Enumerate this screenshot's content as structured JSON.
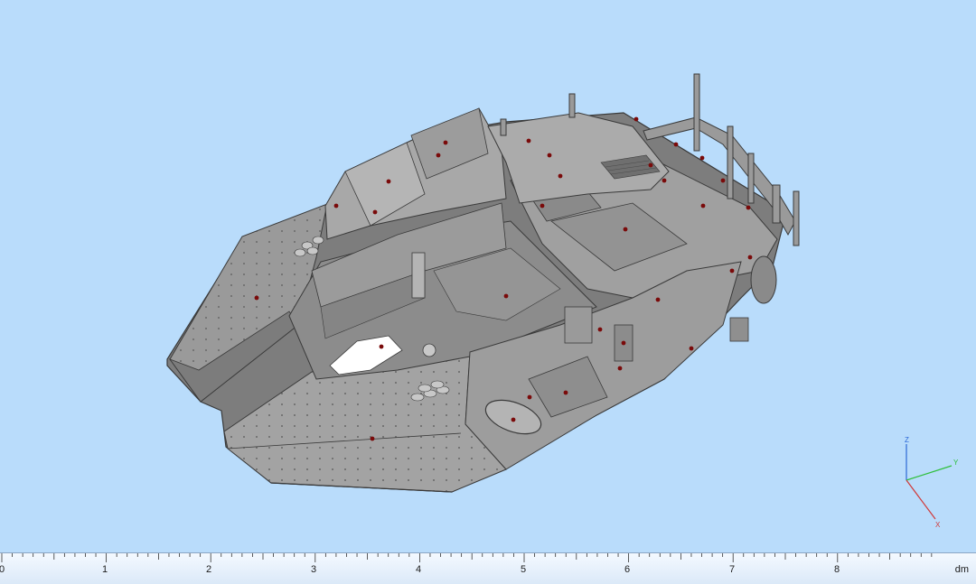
{
  "viewport": {
    "background": "#b9dcfb",
    "model": {
      "body_color": "#8e8e8e",
      "marker_color": "#7a0a0a"
    },
    "triad": {
      "z_label": "Z",
      "y_label": "Y",
      "x_label": "X",
      "z_color": "#2b66d6",
      "y_color": "#2fbf3c",
      "x_color": "#d03a3a"
    }
  },
  "ruler": {
    "ticks": [
      "0",
      "1",
      "2",
      "3",
      "4",
      "5",
      "6",
      "7",
      "8"
    ],
    "unit": "dm"
  }
}
